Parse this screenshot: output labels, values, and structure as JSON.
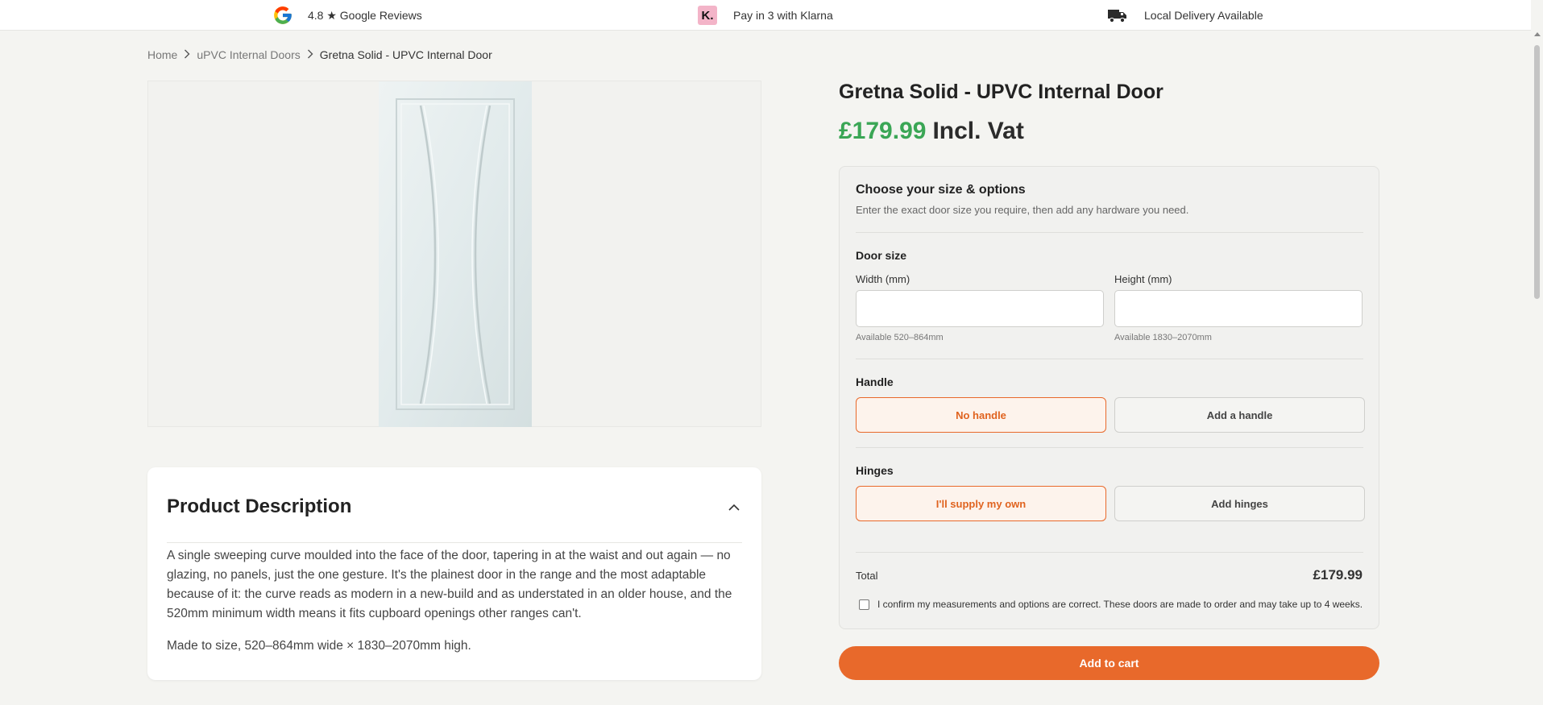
{
  "topbar": {
    "reviews": "4.8 ★ Google Reviews",
    "klarna_badge": "K.",
    "klarna": "Pay in 3 with Klarna",
    "delivery": "Local Delivery Available"
  },
  "breadcrumb": {
    "home": "Home",
    "category": "uPVC Internal Doors",
    "current": "Gretna Solid - UPVC Internal Door"
  },
  "product": {
    "title": "Gretna Solid - UPVC Internal Door",
    "price": "£179.99",
    "vat_label": "Incl. Vat"
  },
  "options": {
    "heading": "Choose your size & options",
    "subheading": "Enter the exact door size you require, then add any hardware you need.",
    "door_size_label": "Door size",
    "width_label": "Width (mm)",
    "width_value": "",
    "width_hint": "Available 520–864mm",
    "height_label": "Height (mm)",
    "height_value": "",
    "height_hint": "Available 1830–2070mm",
    "handle_label": "Handle",
    "handle_options": [
      "No handle",
      "Add a handle"
    ],
    "handle_selected": "No handle",
    "hinges_label": "Hinges",
    "hinge_options": [
      "I'll supply my own",
      "Add hinges"
    ],
    "hinges_selected": "I'll supply my own",
    "total_label": "Total",
    "total_value": "£179.99",
    "confirm_text": "I confirm my measurements and options are correct. These doors are made to order and may take up to 4 weeks."
  },
  "cart": {
    "label": "Add to cart"
  },
  "description": {
    "heading": "Product Description",
    "paragraph1": "A single sweeping curve moulded into the face of the door, tapering in at the waist and out again — no glazing, no panels, just the one gesture. It's the plainest door in the range and the most adaptable because of it: the curve reads as modern in a new-build and as understated in an older house, and the 520mm minimum width means it fits cupboard openings other ranges can't.",
    "paragraph2": "Made to size, 520–864mm wide × 1830–2070mm high."
  },
  "colors": {
    "accent_orange": "#e8692b",
    "price_green": "#3aa655",
    "klarna_pink": "#f3b4c8"
  },
  "icons": {
    "reviews": "google-g-icon",
    "klarna": "klarna-k-icon",
    "delivery": "delivery-truck-icon",
    "breadcrumb_sep": "chevron-right-icon",
    "collapse": "chevron-up-icon"
  }
}
